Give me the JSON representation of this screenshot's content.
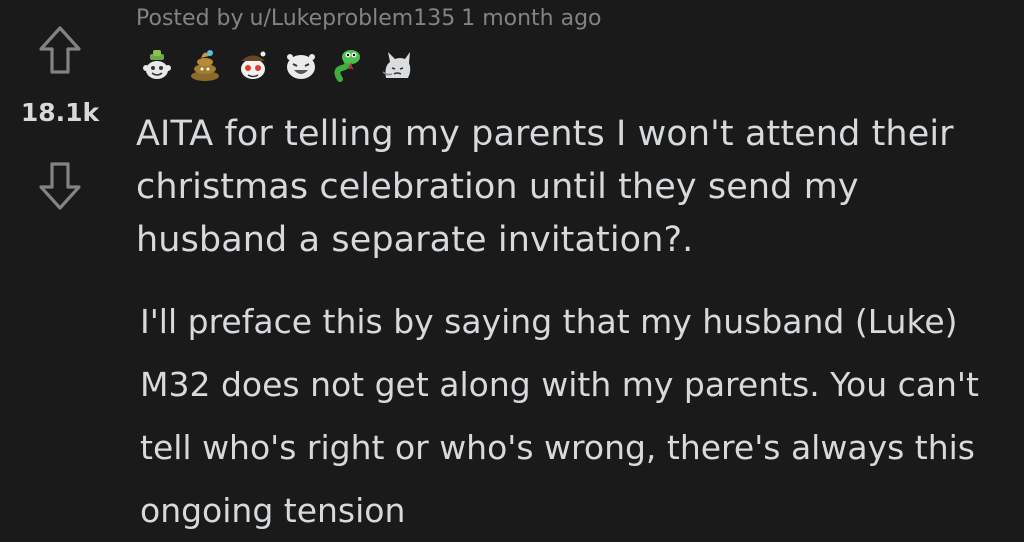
{
  "post": {
    "meta": {
      "posted_by_prefix": "Posted by",
      "username": "u/Lukeproblem135",
      "time": "1 month ago"
    },
    "score": "18.1k",
    "awards": [
      {
        "icon": "wholesome-award-icon"
      },
      {
        "icon": "poop-award-icon"
      },
      {
        "icon": "snoo-award-icon"
      },
      {
        "icon": "laughing-face-award-icon"
      },
      {
        "icon": "green-snake-award-icon"
      },
      {
        "icon": "cat-award-icon"
      }
    ],
    "title": "AITA for telling my parents I won't attend their christmas celebration until they send my husband a separate invitation?.",
    "body": "I'll preface this by saying that my husband (Luke) M32 does not get along with my parents. You can't tell who's right or who's wrong, there's always this ongoing tension"
  },
  "icons": {
    "upvote": "upvote-arrow-icon",
    "downvote": "downvote-arrow-icon"
  },
  "colors": {
    "background": "#1a1a1b",
    "text": "#d7dadc",
    "meta_text": "#818384",
    "vote_icon": "#818384"
  }
}
